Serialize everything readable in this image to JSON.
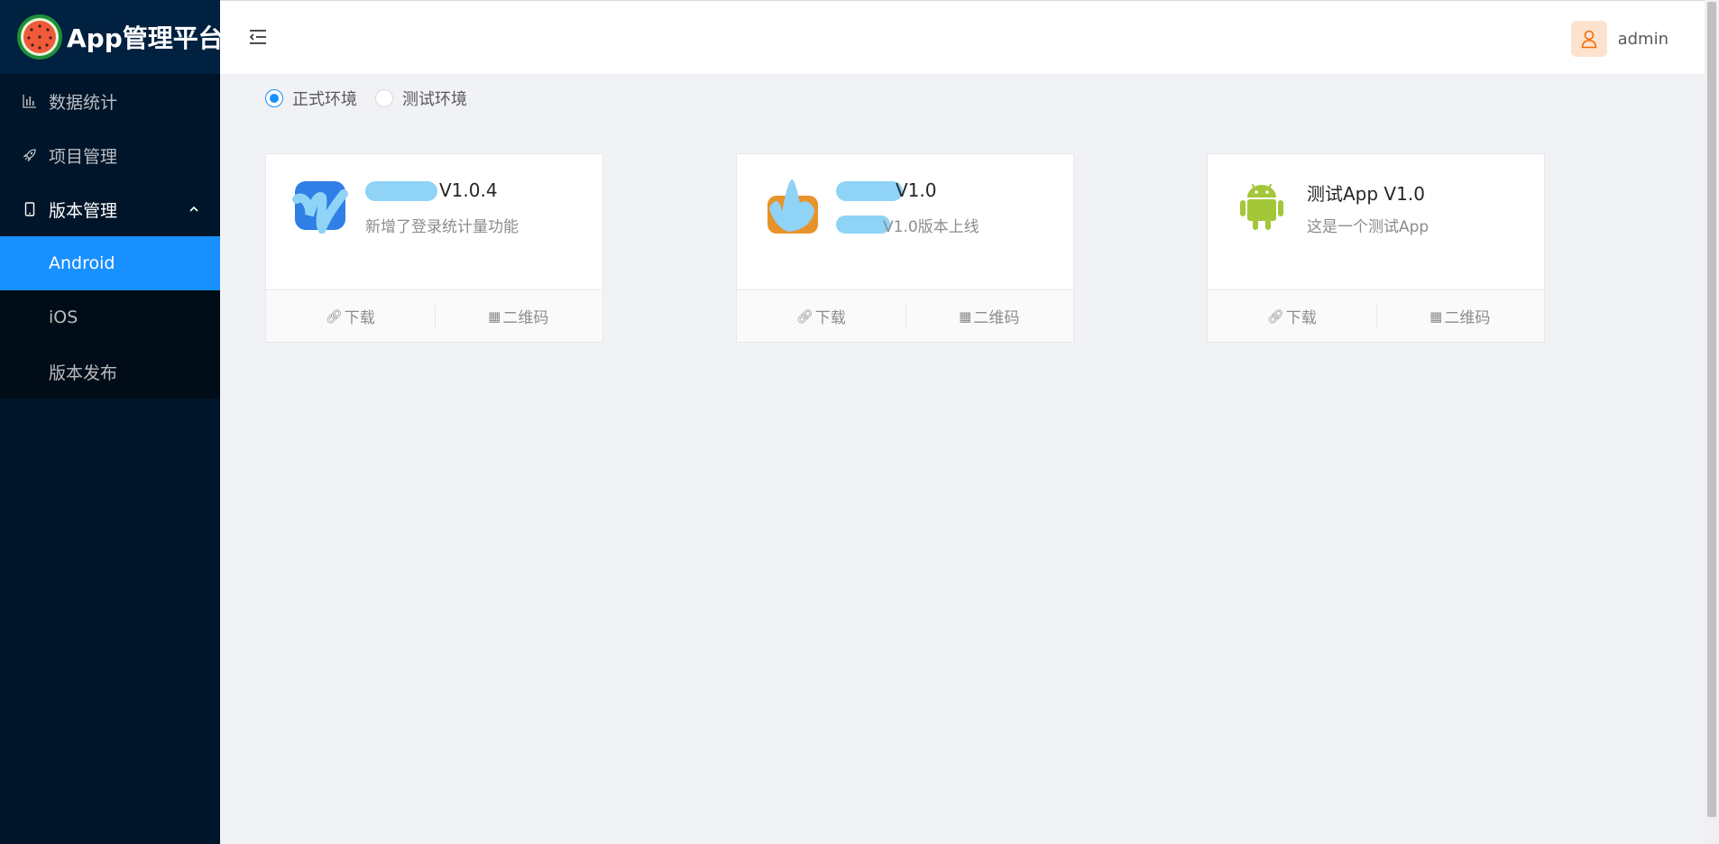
{
  "app": {
    "title": "App管理平台",
    "logo_icon": "watermelon-logo-icon"
  },
  "sidebar": {
    "items": [
      {
        "label": "数据统计",
        "icon": "bar-chart-icon"
      },
      {
        "label": "项目管理",
        "icon": "rocket-icon"
      },
      {
        "label": "版本管理",
        "icon": "mobile-icon",
        "expanded": true
      }
    ],
    "submenu": [
      {
        "label": "Android",
        "active": true
      },
      {
        "label": "iOS"
      },
      {
        "label": "版本发布"
      }
    ]
  },
  "header": {
    "collapse_icon": "menu-fold-icon",
    "user_name": "admin",
    "avatar_icon": "user-icon"
  },
  "environment": {
    "options": [
      {
        "label": "正式环境",
        "checked": true
      },
      {
        "label": "测试环境",
        "checked": false
      }
    ]
  },
  "cards": [
    {
      "title_suffix": "V1.0.4",
      "description": "新增了登录统计量功能",
      "download_label": "下载",
      "qrcode_label": "二维码",
      "icon": "app-icon-redacted"
    },
    {
      "title_suffix": "V1.0",
      "description": "V1.0版本上线",
      "download_label": "下载",
      "qrcode_label": "二维码",
      "icon": "app-icon-redacted"
    },
    {
      "title": "测试App V1.0",
      "description": "这是一个测试App",
      "download_label": "下载",
      "qrcode_label": "二维码",
      "icon": "android-icon"
    }
  ],
  "colors": {
    "sidebar_bg": "#001529",
    "accent": "#1890ff",
    "content_bg": "#f0f2f5",
    "android_green": "#a4c639"
  }
}
